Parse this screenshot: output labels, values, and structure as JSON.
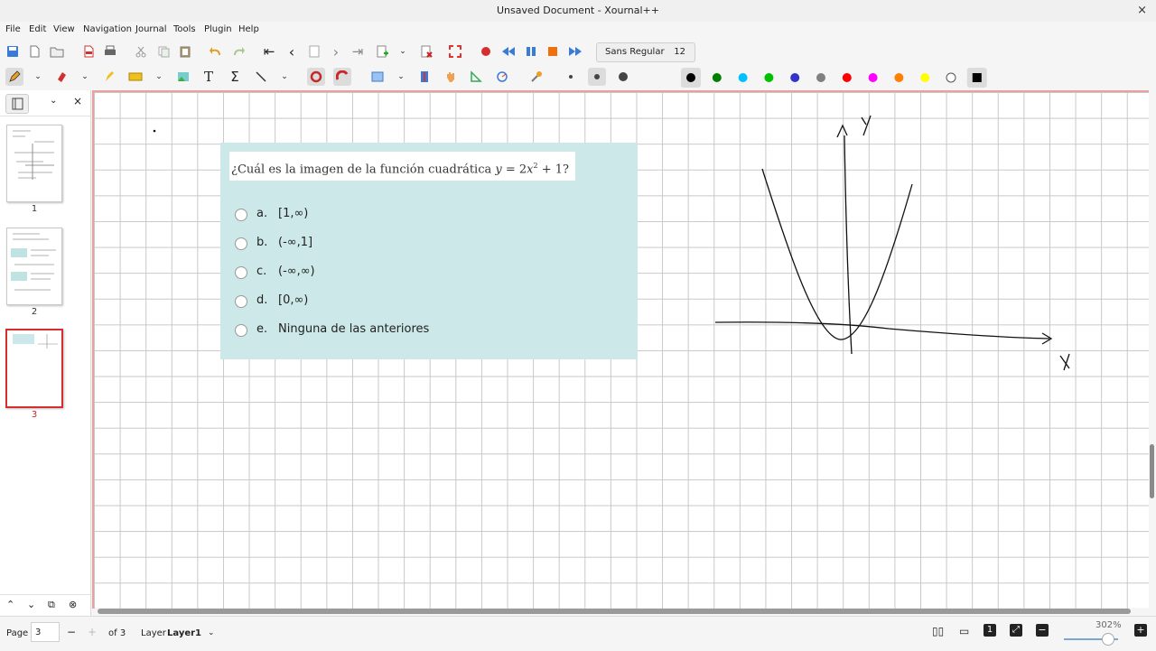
{
  "window": {
    "title": "Unsaved Document - Xournal++",
    "close_glyph": "×"
  },
  "menu": [
    "File",
    "Edit",
    "View",
    "Navigation",
    "Journal",
    "Tools",
    "Plugin",
    "Help"
  ],
  "toolbar": {
    "font_name": "Sans Regular",
    "font_size": "12",
    "colors": [
      "#000000",
      "#008000",
      "#00c0ff",
      "#00c000",
      "#3333cc",
      "#808080",
      "#ff0000",
      "#ff00ff",
      "#ff8000",
      "#ffff00",
      "#ffffff"
    ],
    "selected_color": "#000000"
  },
  "sidebar": {
    "pages": [
      {
        "number": "1",
        "active": false
      },
      {
        "number": "2",
        "active": false
      },
      {
        "number": "3",
        "active": true
      }
    ]
  },
  "quiz": {
    "question_prefix": "¿Cuál es la imagen de la función cuadrática ",
    "question_math_var": "y",
    "question_math_eq": " = 2",
    "question_math_x": "x",
    "question_math_exp": "2",
    "question_math_tail": " + 1?",
    "options": [
      {
        "letter": "a.",
        "text": "[1,∞)"
      },
      {
        "letter": "b.",
        "text": "(-∞,1]"
      },
      {
        "letter": "c.",
        "text": "(-∞,∞)"
      },
      {
        "letter": "d.",
        "text": "[0,∞)"
      },
      {
        "letter": "e.",
        "text": "Ninguna de las anteriores"
      }
    ]
  },
  "statusbar": {
    "page_label": "Page",
    "page_value": "3",
    "minus": "−",
    "plus": "+",
    "of_pages": "of 3",
    "layer_label": "Layer",
    "layer_value": "Layer1",
    "zoom": "302%"
  }
}
